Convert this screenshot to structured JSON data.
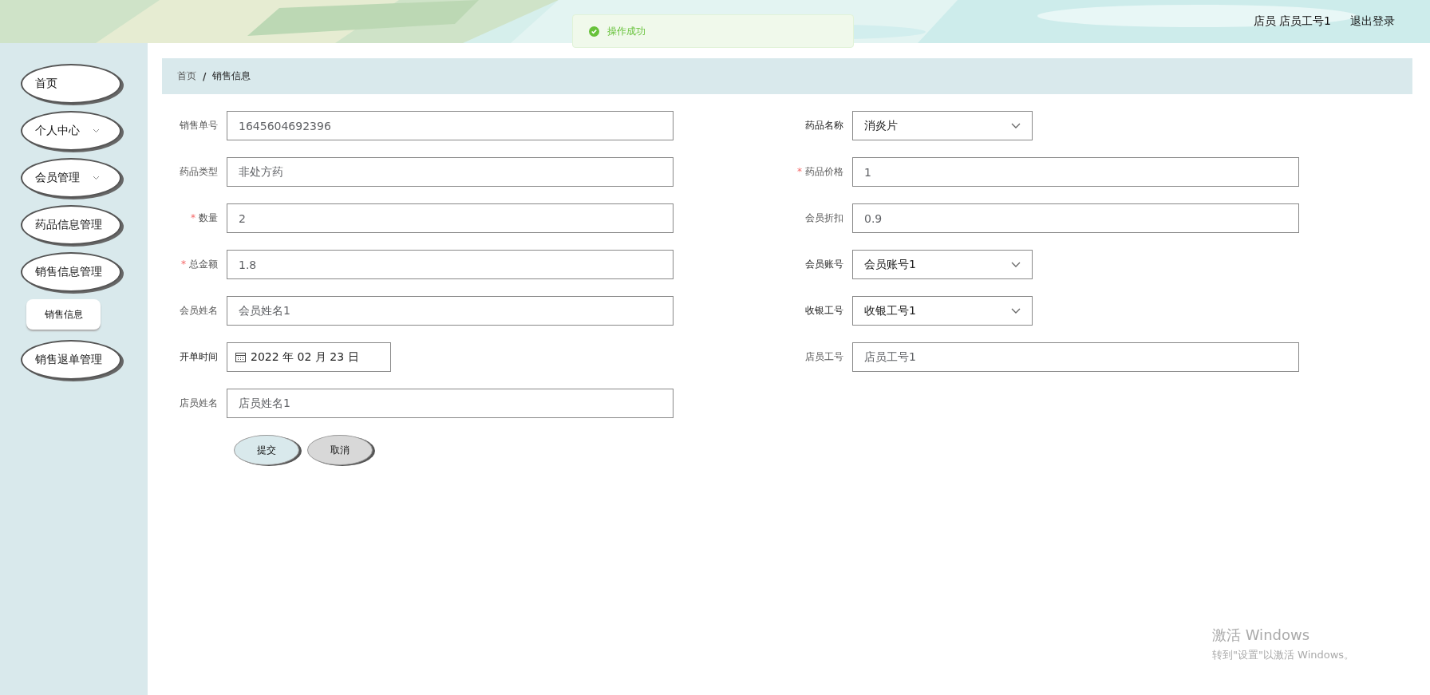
{
  "header": {
    "user_role": "店员",
    "user_name": "店员工号1",
    "logout": "退出登录"
  },
  "toast": {
    "message": "操作成功"
  },
  "sidebar": {
    "items": [
      {
        "label": "首页",
        "has_children": false
      },
      {
        "label": "个人中心",
        "has_children": true
      },
      {
        "label": "会员管理",
        "has_children": true
      },
      {
        "label": "药品信息管理",
        "has_children": false
      },
      {
        "label": "销售信息管理",
        "has_children": false,
        "children": [
          {
            "label": "销售信息"
          }
        ]
      },
      {
        "label": "销售退单管理",
        "has_children": false
      }
    ]
  },
  "breadcrumb": {
    "items": [
      "首页",
      "销售信息"
    ],
    "separator": "/"
  },
  "form": {
    "left": [
      {
        "kind": "input",
        "label": "销售单号",
        "value": "1645604692396"
      },
      {
        "kind": "input",
        "label": "药品类型",
        "value": "非处方药"
      },
      {
        "kind": "input",
        "label": "数量",
        "value": "2",
        "required_mark": "*"
      },
      {
        "kind": "input",
        "label": "总金额",
        "value": "1.8",
        "required_mark": "*"
      },
      {
        "kind": "input",
        "label": "会员姓名",
        "value": "会员姓名1"
      },
      {
        "kind": "date",
        "label": "开单时间",
        "value": "2022 年 02 月 23 日"
      },
      {
        "kind": "input",
        "label": "店员姓名",
        "value": "店员姓名1"
      }
    ],
    "right": [
      {
        "kind": "select",
        "label": "药品名称",
        "value": "消炎片"
      },
      {
        "kind": "input",
        "label": "药品价格",
        "value": "1",
        "required_mark": "*"
      },
      {
        "kind": "input",
        "label": "会员折扣",
        "value": "0.9"
      },
      {
        "kind": "select",
        "label": "会员账号",
        "value": "会员账号1"
      },
      {
        "kind": "select",
        "label": "收银工号",
        "value": "收银工号1"
      },
      {
        "kind": "input",
        "label": "店员工号",
        "value": "店员工号1"
      }
    ],
    "buttons": [
      {
        "kind": "submit",
        "label": "提交"
      },
      {
        "kind": "cancel",
        "label": "取消"
      }
    ]
  },
  "os_notice": {
    "title": "激活 Windows",
    "subtitle": "转到\"设置\"以激活 Windows。"
  }
}
